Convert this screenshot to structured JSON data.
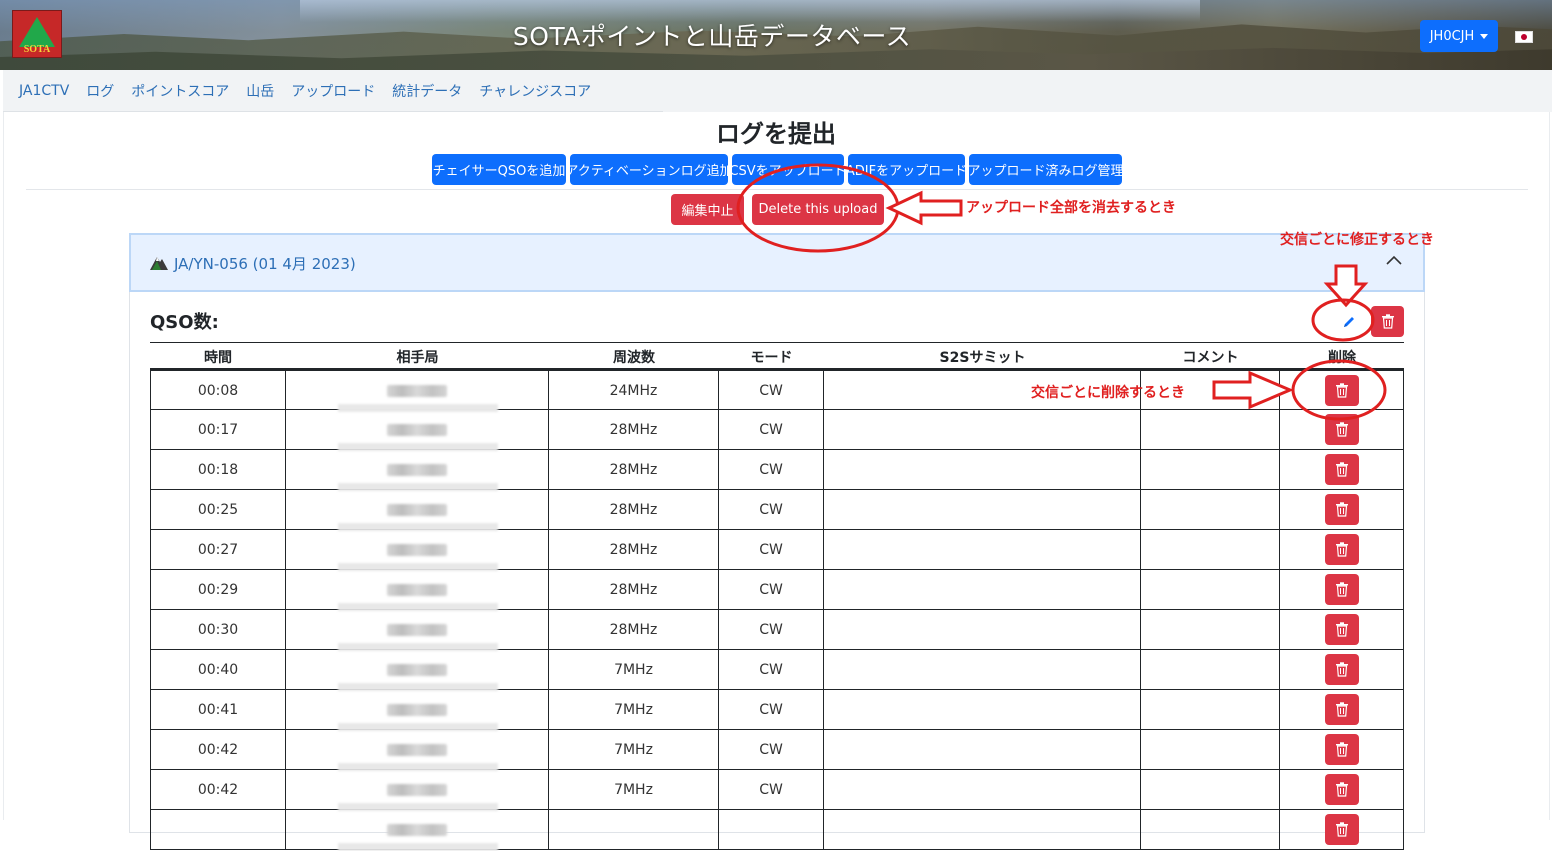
{
  "header": {
    "logo_text": "SOTA",
    "title": "SOTAポイントと山岳データベース",
    "user_label": "JH0CJH"
  },
  "nav": {
    "items": [
      "JA1CTV",
      "ログ",
      "ポイントスコア",
      "山岳",
      "アップロード",
      "統計データ",
      "チャレンジスコア"
    ]
  },
  "page": {
    "title": "ログを提出",
    "buttons": [
      "チェイサーQSOを追加",
      "アクティベーションログ追加",
      "CSVをアップロード",
      "ADIFをアップロード",
      "アップロード済みログ管理"
    ],
    "stop_edit_label": "編集中止",
    "delete_upload_label": "Delete this upload"
  },
  "annotations": {
    "delete_all": "アップロード全部を消去するとき",
    "edit_each": "交信ごとに修正するとき",
    "delete_each": "交信ごとに削除するとき"
  },
  "card": {
    "summit": "JA/YN-056 (01 4月 2023)",
    "qso_label": "QSO数:"
  },
  "table": {
    "headers": [
      "時間",
      "相手局",
      "周波数",
      "モード",
      "S2Sサミット",
      "コメント",
      "削除"
    ],
    "rows": [
      {
        "time": "00:08",
        "freq": "24MHz",
        "mode": "CW"
      },
      {
        "time": "00:17",
        "freq": "28MHz",
        "mode": "CW"
      },
      {
        "time": "00:18",
        "freq": "28MHz",
        "mode": "CW"
      },
      {
        "time": "00:25",
        "freq": "28MHz",
        "mode": "CW"
      },
      {
        "time": "00:27",
        "freq": "28MHz",
        "mode": "CW"
      },
      {
        "time": "00:29",
        "freq": "28MHz",
        "mode": "CW"
      },
      {
        "time": "00:30",
        "freq": "28MHz",
        "mode": "CW"
      },
      {
        "time": "00:40",
        "freq": "7MHz",
        "mode": "CW"
      },
      {
        "time": "00:41",
        "freq": "7MHz",
        "mode": "CW"
      },
      {
        "time": "00:42",
        "freq": "7MHz",
        "mode": "CW"
      },
      {
        "time": "00:42",
        "freq": "7MHz",
        "mode": "CW"
      },
      {
        "time": "",
        "freq": "",
        "mode": ""
      }
    ]
  },
  "colors": {
    "primary": "#0d6efd",
    "danger": "#dc3545",
    "link": "#2d6fb6",
    "annotation": "#e02020"
  },
  "icons": {
    "edit": "pencil-icon",
    "delete": "trash-icon",
    "collapse": "chevron-up-icon",
    "summit": "mountain-icon",
    "dropdown": "caret-down-icon"
  }
}
